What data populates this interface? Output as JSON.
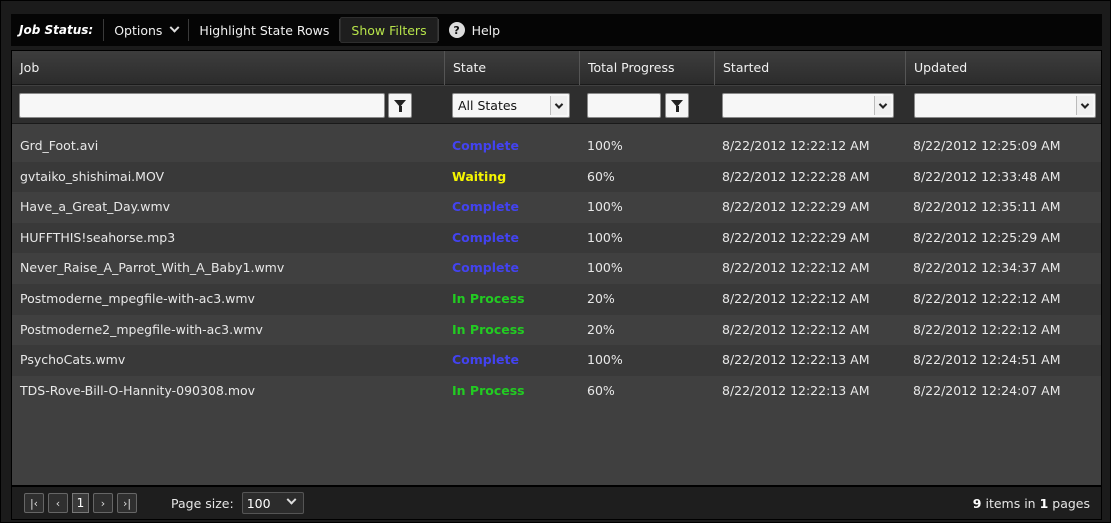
{
  "toolbar": {
    "title": "Job Status:",
    "options_label": "Options",
    "highlight_label": "Highlight State Rows",
    "show_filters_label": "Show Filters",
    "help_label": "Help"
  },
  "columns": [
    "Job",
    "State",
    "Total Progress",
    "Started",
    "Updated"
  ],
  "filters": {
    "job_value": "",
    "state_selected": "All States",
    "progress_value": "",
    "started_value": "",
    "updated_value": ""
  },
  "state_colors": {
    "Complete": "#4343f0",
    "Waiting": "#f5f500",
    "In Process": "#22cc22"
  },
  "rows": [
    {
      "job": "Grd_Foot.avi",
      "state": "Complete",
      "progress": "100%",
      "started": "8/22/2012 12:22:12 AM",
      "updated": "8/22/2012 12:25:09 AM"
    },
    {
      "job": "gvtaiko_shishimai.MOV",
      "state": "Waiting",
      "progress": "60%",
      "started": "8/22/2012 12:22:28 AM",
      "updated": "8/22/2012 12:33:48 AM"
    },
    {
      "job": "Have_a_Great_Day.wmv",
      "state": "Complete",
      "progress": "100%",
      "started": "8/22/2012 12:22:29 AM",
      "updated": "8/22/2012 12:35:11 AM"
    },
    {
      "job": "HUFFTHIS!seahorse.mp3",
      "state": "Complete",
      "progress": "100%",
      "started": "8/22/2012 12:22:29 AM",
      "updated": "8/22/2012 12:25:29 AM"
    },
    {
      "job": "Never_Raise_A_Parrot_With_A_Baby1.wmv",
      "state": "Complete",
      "progress": "100%",
      "started": "8/22/2012 12:22:12 AM",
      "updated": "8/22/2012 12:34:37 AM"
    },
    {
      "job": "Postmoderne_mpegfile-with-ac3.wmv",
      "state": "In Process",
      "progress": "20%",
      "started": "8/22/2012 12:22:12 AM",
      "updated": "8/22/2012 12:22:12 AM"
    },
    {
      "job": "Postmoderne2_mpegfile-with-ac3.wmv",
      "state": "In Process",
      "progress": "20%",
      "started": "8/22/2012 12:22:12 AM",
      "updated": "8/22/2012 12:22:12 AM"
    },
    {
      "job": "PsychoCats.wmv",
      "state": "Complete",
      "progress": "100%",
      "started": "8/22/2012 12:22:13 AM",
      "updated": "8/22/2012 12:24:51 AM"
    },
    {
      "job": "TDS-Rove-Bill-O-Hannity-090308.mov",
      "state": "In Process",
      "progress": "60%",
      "started": "8/22/2012 12:22:13 AM",
      "updated": "8/22/2012 12:24:07 AM"
    }
  ],
  "pager": {
    "current_page": "1",
    "page_size_label": "Page size:",
    "page_size": "100",
    "items_count": "9",
    "items_text": "items in",
    "pages_count": "1",
    "pages_text": "pages"
  }
}
